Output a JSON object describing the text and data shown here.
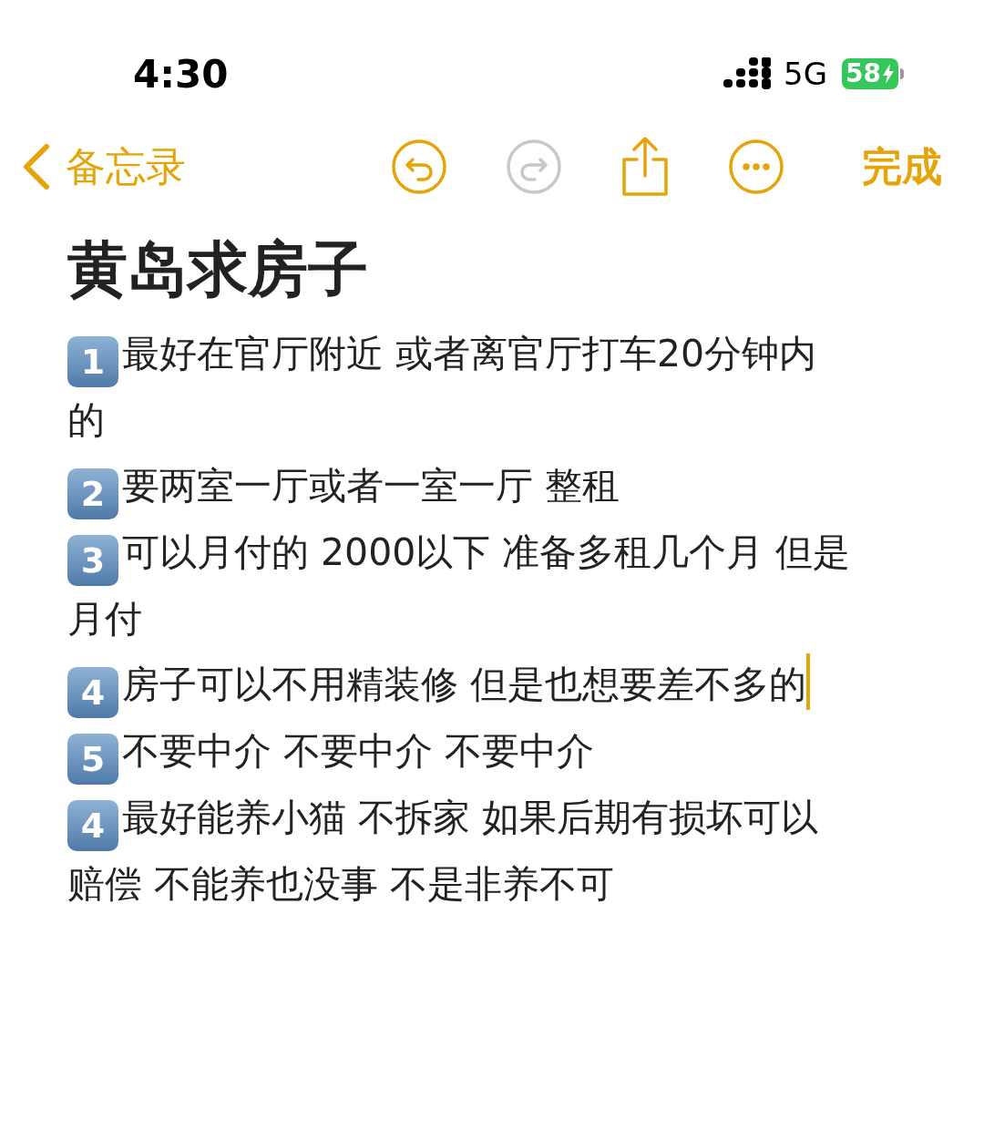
{
  "status_bar": {
    "time": "4:30",
    "network": "5G",
    "battery": "58",
    "charging": true
  },
  "nav": {
    "back_label": "备忘录",
    "undo_enabled": true,
    "redo_enabled": false,
    "done_label": "完成"
  },
  "note": {
    "title": "黄岛求房子",
    "items": [
      {
        "number": "1",
        "text": "最好在官厅附近 或者离官厅打车20分钟内的",
        "cursor": false
      },
      {
        "number": "2",
        "text": "要两室一厅或者一室一厅 整租",
        "cursor": false
      },
      {
        "number": "3",
        "text": "可以月付的 2000以下 准备多租几个月 但是月付",
        "cursor": false
      },
      {
        "number": "4",
        "text": "房子可以不用精装修 但是也想要差不多的",
        "cursor": true
      },
      {
        "number": "5",
        "text": "不要中介 不要中介 不要中介",
        "cursor": false
      },
      {
        "number": "4",
        "text": "最好能养小猫 不拆家 如果后期有损坏可以赔偿 不能养也没事 不是非养不可",
        "cursor": false
      }
    ]
  }
}
